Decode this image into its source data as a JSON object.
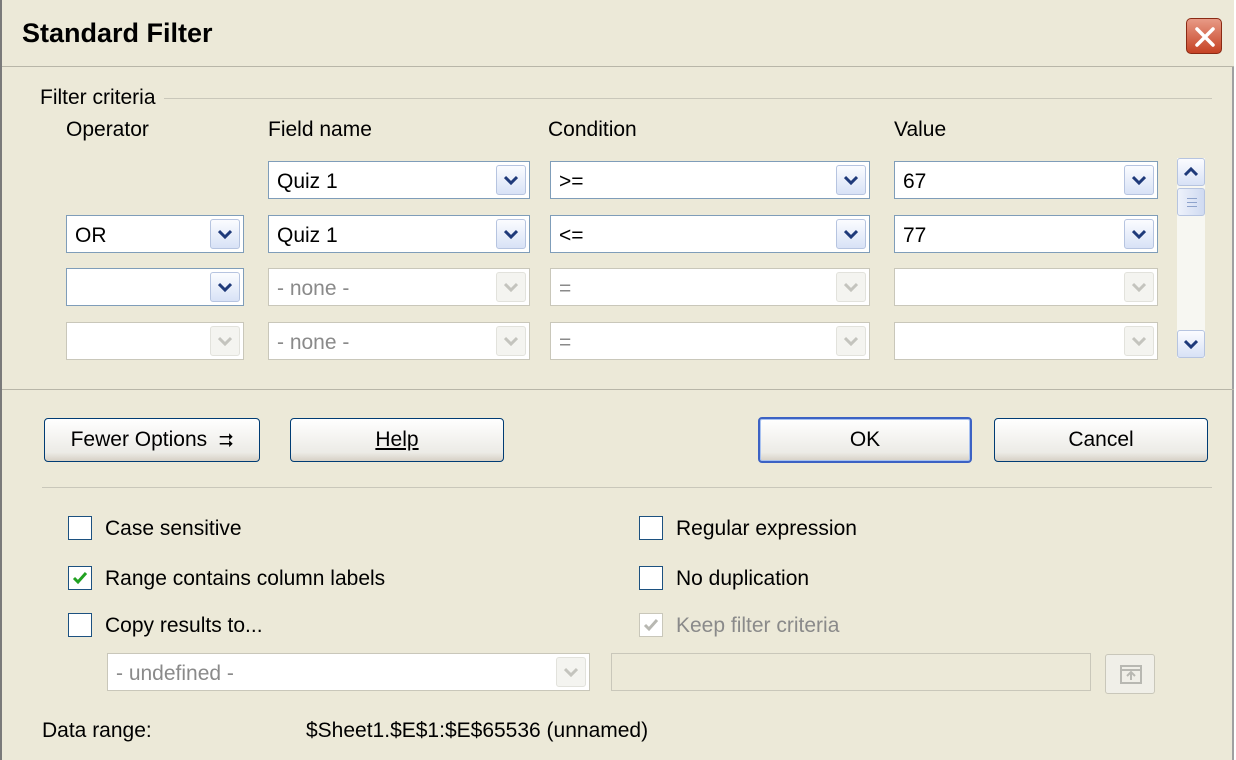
{
  "window": {
    "title": "Standard Filter",
    "close_label": ""
  },
  "filter_criteria": {
    "group_label": "Filter criteria",
    "headers": {
      "operator": "Operator",
      "field_name": "Field name",
      "condition": "Condition",
      "value": "Value"
    },
    "rows": [
      {
        "operator": "",
        "field": "Quiz 1",
        "condition": ">=",
        "value": "67"
      },
      {
        "operator": "OR",
        "field": "Quiz 1",
        "condition": "<=",
        "value": "77"
      },
      {
        "operator": "",
        "field": "- none -",
        "condition": "=",
        "value": ""
      },
      {
        "operator": "",
        "field": "- none -",
        "condition": "=",
        "value": ""
      }
    ]
  },
  "buttons": {
    "fewer_options": "Fewer Options",
    "fewer_options_arrow": "⮆",
    "help": "Help",
    "ok": "OK",
    "cancel": "Cancel"
  },
  "options": {
    "case_sensitive": {
      "label": "Case sensitive",
      "checked": false
    },
    "range_contains_column_labels": {
      "label": "Range contains column labels",
      "checked": true
    },
    "copy_results_to": {
      "label": "Copy results to...",
      "checked": false
    },
    "regular_expression": {
      "label": "Regular expression",
      "checked": false
    },
    "no_duplication": {
      "label": "No duplication",
      "checked": false
    },
    "keep_filter_criteria": {
      "label": "Keep filter criteria",
      "checked": true,
      "disabled": true
    }
  },
  "copy_target": {
    "combo_value": "- undefined -",
    "text_value": ""
  },
  "data_range": {
    "label": "Data range:",
    "value": "$Sheet1.$E$1:$E$65536 (unnamed)"
  },
  "colors": {
    "dialog_bg": "#ece9d8",
    "field_border": "#7f9db9",
    "close_red": "#c64224",
    "default_button_border": "#3c62c4"
  }
}
